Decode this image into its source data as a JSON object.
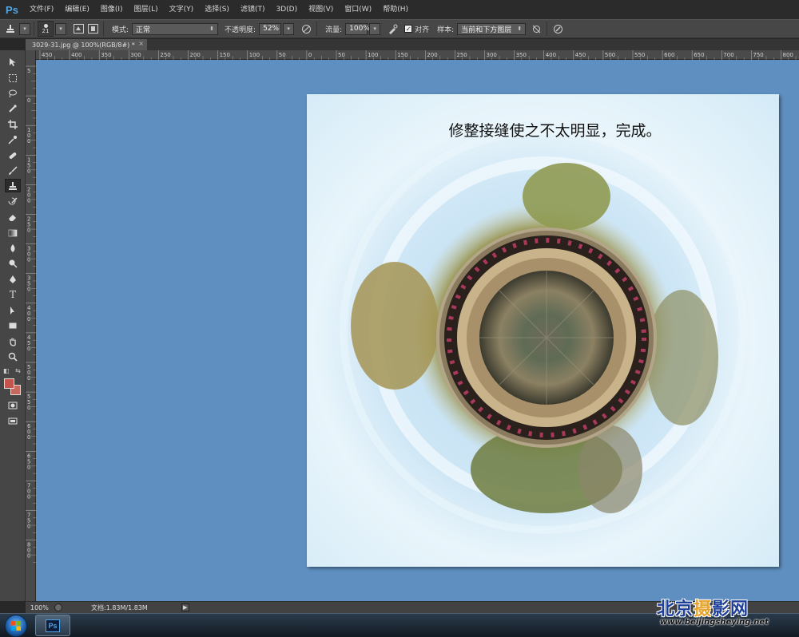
{
  "app": {
    "logo": "Ps"
  },
  "menu": [
    "文件(F)",
    "编辑(E)",
    "图像(I)",
    "图层(L)",
    "文字(Y)",
    "选择(S)",
    "滤镜(T)",
    "3D(D)",
    "视图(V)",
    "窗口(W)",
    "帮助(H)"
  ],
  "options": {
    "brush_size": "21",
    "mode_label": "模式:",
    "mode_value": "正常",
    "opacity_label": "不透明度:",
    "opacity_value": "52%",
    "flow_label": "流量:",
    "flow_value": "100%",
    "align_label": "对齐",
    "align_checked": true,
    "sample_label": "样本:",
    "sample_value": "当前和下方图层"
  },
  "document_tab": {
    "title": "3029-31.jpg @ 100%(RGB/8#) *",
    "close": "×"
  },
  "ruler_h_labels": [
    "450",
    "400",
    "350",
    "300",
    "250",
    "200",
    "150",
    "100",
    "50",
    "0",
    "50",
    "100",
    "150",
    "200",
    "250",
    "300",
    "350",
    "400",
    "450",
    "500",
    "550",
    "600",
    "650",
    "700",
    "750",
    "800"
  ],
  "ruler_v_labels": [
    "5",
    "0",
    "1 0 0",
    "1 5 0",
    "2 0 0",
    "2 5 0",
    "3 0 0",
    "3 5 0",
    "4 0 0",
    "4 5 0",
    "5 0 0",
    "5 5 0",
    "6 0 0",
    "6 5 0",
    "7 0 0",
    "7 5 0",
    "8 0 0"
  ],
  "canvas": {
    "background_color": "#5f8fc0",
    "caption": "修整接缝使之不太明显，完成。"
  },
  "status": {
    "zoom": "100%",
    "doc_info": "文档:1.83M/1.83M",
    "arrow": "▶"
  },
  "tools": [
    "move-tool",
    "marquee-tool",
    "lasso-tool",
    "quick-select-tool",
    "crop-tool",
    "eyedropper-tool",
    "healing-brush-tool",
    "brush-tool",
    "clone-stamp-tool",
    "history-brush-tool",
    "eraser-tool",
    "gradient-tool",
    "blur-tool",
    "dodge-tool",
    "pen-tool",
    "type-tool",
    "path-select-tool",
    "rectangle-tool",
    "hand-tool",
    "zoom-tool"
  ],
  "colors": {
    "foreground": "#c4554d",
    "background": "#c66a60",
    "accent": "#4fa7e8"
  },
  "watermark": {
    "title_a": "北京",
    "title_b": "摄",
    "title_c": "影网",
    "url": "www.beijingsheying.net"
  }
}
